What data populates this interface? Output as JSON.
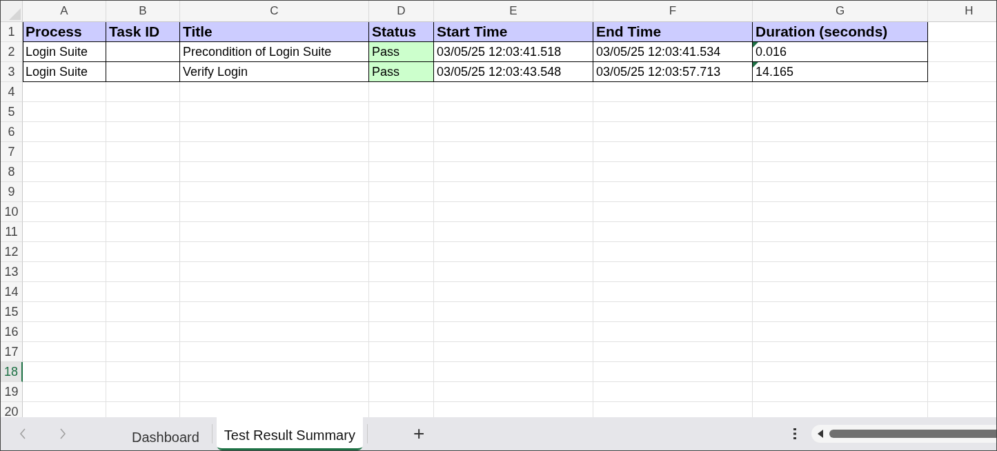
{
  "columns": [
    "A",
    "B",
    "C",
    "D",
    "E",
    "F",
    "G",
    "H"
  ],
  "row_headers": [
    {
      "label": "1",
      "selected": false
    },
    {
      "label": "2",
      "selected": false
    },
    {
      "label": "3",
      "selected": false
    },
    {
      "label": "4",
      "selected": false
    },
    {
      "label": "5",
      "selected": false
    },
    {
      "label": "6",
      "selected": false
    },
    {
      "label": "7",
      "selected": false
    },
    {
      "label": "8",
      "selected": false
    },
    {
      "label": "9",
      "selected": false
    },
    {
      "label": "10",
      "selected": false
    },
    {
      "label": "11",
      "selected": false
    },
    {
      "label": "12",
      "selected": false
    },
    {
      "label": "13",
      "selected": false
    },
    {
      "label": "14",
      "selected": false
    },
    {
      "label": "15",
      "selected": false
    },
    {
      "label": "16",
      "selected": false
    },
    {
      "label": "17",
      "selected": false
    },
    {
      "label": "18",
      "selected": true
    },
    {
      "label": "19",
      "selected": false
    },
    {
      "label": "20",
      "selected": false
    }
  ],
  "rows": [
    {
      "cells": [
        {
          "kind": "header",
          "text": "Process"
        },
        {
          "kind": "header",
          "text": "Task ID"
        },
        {
          "kind": "header",
          "text": "Title"
        },
        {
          "kind": "header",
          "text": "Status"
        },
        {
          "kind": "header",
          "text": "Start Time"
        },
        {
          "kind": "header",
          "text": "End Time"
        },
        {
          "kind": "header",
          "text": "Duration (seconds)"
        }
      ]
    },
    {
      "cells": [
        {
          "kind": "text",
          "text": "Login Suite"
        },
        {
          "kind": "empty"
        },
        {
          "kind": "text",
          "text": "Precondition of Login Suite"
        },
        {
          "kind": "pass",
          "text": "Pass"
        },
        {
          "kind": "text",
          "text": "03/05/25 12:03:41.518"
        },
        {
          "kind": "text",
          "text": "03/05/25 12:03:41.534"
        },
        {
          "kind": "flagged",
          "text": "0.016"
        }
      ]
    },
    {
      "cells": [
        {
          "kind": "text",
          "text": "Login Suite"
        },
        {
          "kind": "empty"
        },
        {
          "kind": "text",
          "text": "Verify Login"
        },
        {
          "kind": "pass",
          "text": "Pass"
        },
        {
          "kind": "text",
          "text": "03/05/25 12:03:43.548"
        },
        {
          "kind": "text",
          "text": "03/05/25 12:03:57.713"
        },
        {
          "kind": "flagged",
          "text": "14.165"
        }
      ]
    }
  ],
  "sheet_tabs": [
    {
      "label": "Dashboard",
      "selected": false
    },
    {
      "label": "Test Result Summary",
      "selected": true
    }
  ],
  "add_sheet": "+"
}
